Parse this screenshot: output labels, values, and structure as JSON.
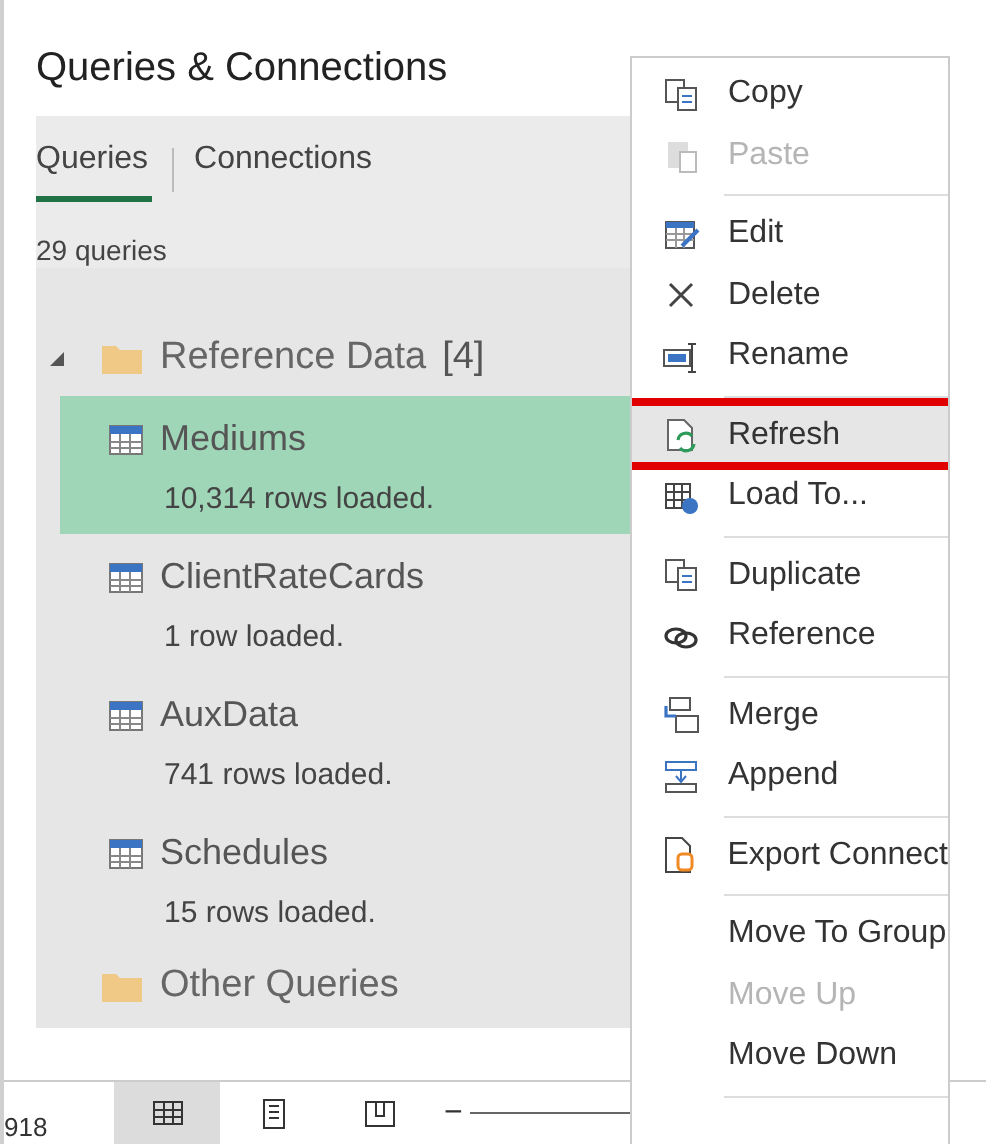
{
  "panel": {
    "title": "Queries & Connections",
    "tabs": [
      {
        "label": "Queries",
        "selected": true
      },
      {
        "label": "Connections",
        "selected": false
      }
    ],
    "count": "29 queries",
    "groups": [
      {
        "name": "Reference Data",
        "count": "[4]",
        "expanded": true,
        "children": [
          {
            "name": "Mediums",
            "status": "10,314 rows loaded.",
            "selected": true
          },
          {
            "name": "ClientRateCards",
            "status": "1 row loaded.",
            "selected": false
          },
          {
            "name": "AuxData",
            "status": "741 rows loaded.",
            "selected": false
          },
          {
            "name": "Schedules",
            "status": "15 rows loaded.",
            "selected": false
          }
        ]
      },
      {
        "name": "Other Queries",
        "expanded": false
      }
    ]
  },
  "status_bar": {
    "text": "918",
    "views": [
      {
        "selected": true
      },
      {
        "selected": false
      },
      {
        "selected": false
      }
    ],
    "zoom_minus": "−"
  },
  "context_menu": {
    "items": [
      {
        "kind": "item",
        "label": "Copy",
        "disabled": false,
        "hovered": false,
        "annotated": false
      },
      {
        "kind": "item",
        "label": "Paste",
        "disabled": true,
        "hovered": false,
        "annotated": false
      },
      {
        "kind": "separator"
      },
      {
        "kind": "item",
        "label": "Edit",
        "disabled": false,
        "hovered": false,
        "annotated": false
      },
      {
        "kind": "item",
        "label": "Delete",
        "disabled": false,
        "hovered": false,
        "annotated": false
      },
      {
        "kind": "item",
        "label": "Rename",
        "disabled": false,
        "hovered": false,
        "annotated": false
      },
      {
        "kind": "separator"
      },
      {
        "kind": "item",
        "label": "Refresh",
        "disabled": false,
        "hovered": true,
        "annotated": true
      },
      {
        "kind": "item",
        "label": "Load To...",
        "disabled": false,
        "hovered": false,
        "annotated": false
      },
      {
        "kind": "separator"
      },
      {
        "kind": "item",
        "label": "Duplicate",
        "disabled": false,
        "hovered": false,
        "annotated": false
      },
      {
        "kind": "item",
        "label": "Reference",
        "disabled": false,
        "hovered": false,
        "annotated": false
      },
      {
        "kind": "separator"
      },
      {
        "kind": "item",
        "label": "Merge",
        "disabled": false,
        "hovered": false,
        "annotated": false
      },
      {
        "kind": "item",
        "label": "Append",
        "disabled": false,
        "hovered": false,
        "annotated": false
      },
      {
        "kind": "separator"
      },
      {
        "kind": "item",
        "label": "Export Connect",
        "disabled": false,
        "hovered": false,
        "annotated": false
      },
      {
        "kind": "separator"
      },
      {
        "kind": "item",
        "label": "Move To Group",
        "disabled": false,
        "hovered": false,
        "annotated": false
      },
      {
        "kind": "item",
        "label": "Move Up",
        "disabled": true,
        "hovered": false,
        "annotated": false
      },
      {
        "kind": "item",
        "label": "Move Down",
        "disabled": false,
        "hovered": false,
        "annotated": false
      },
      {
        "kind": "separator"
      }
    ]
  }
}
